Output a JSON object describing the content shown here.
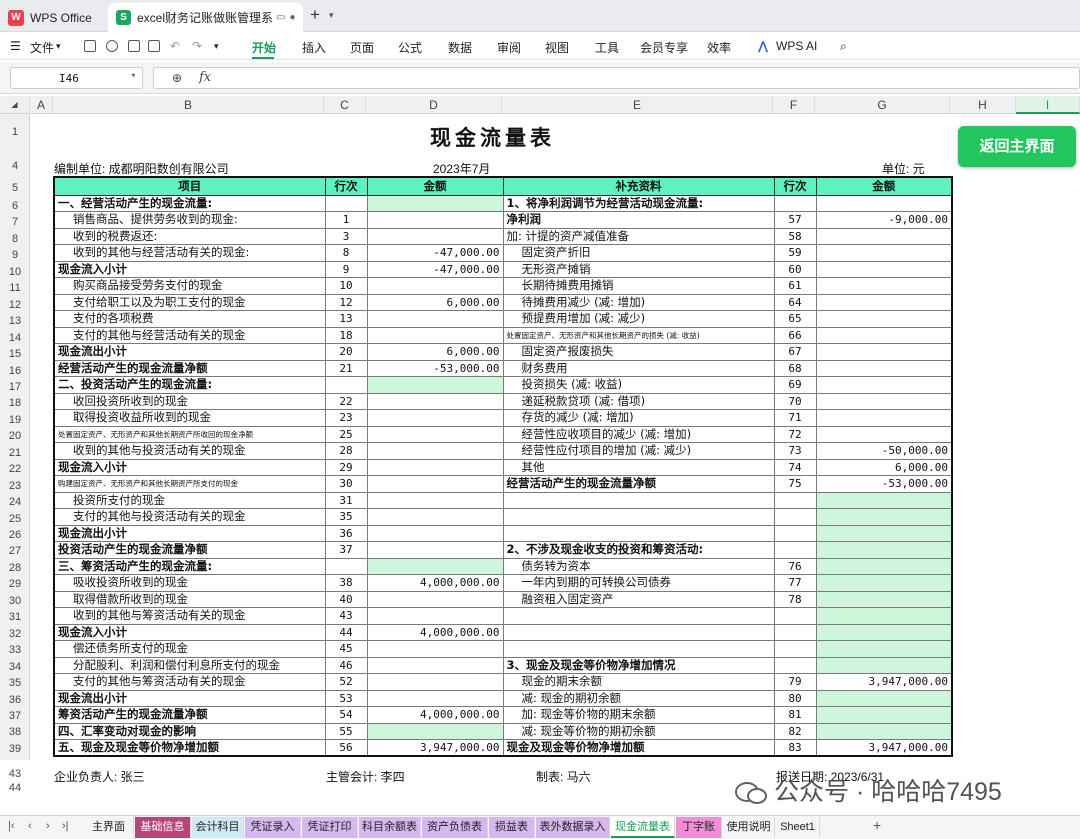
{
  "tabs": {
    "app": "WPS Office",
    "file": "excel财务记账做账管理系统"
  },
  "menu": {
    "file": "文件",
    "items": [
      "开始",
      "插入",
      "页面",
      "公式",
      "数据",
      "审阅",
      "视图",
      "工具",
      "会员专享",
      "效率"
    ],
    "ai": "WPS AI"
  },
  "formula": {
    "cell": "I46",
    "content": ""
  },
  "columns": [
    "A",
    "B",
    "C",
    "D",
    "E",
    "F",
    "G",
    "H",
    "I"
  ],
  "rows": [
    "1",
    "4",
    "5",
    "6",
    "7",
    "8",
    "9",
    "10",
    "11",
    "12",
    "13",
    "14",
    "15",
    "16",
    "17",
    "18",
    "19",
    "20",
    "21",
    "22",
    "23",
    "24",
    "25",
    "26",
    "27",
    "28",
    "29",
    "30",
    "31",
    "32",
    "33",
    "34",
    "35",
    "36",
    "37",
    "38",
    "39",
    "43",
    "44"
  ],
  "report": {
    "title": "现金流量表",
    "unit_label": "编制单位: 成都明阳数创有限公司",
    "period": "2023年7月",
    "currency": "单位: 元",
    "return_button": "返回主界面",
    "headers": [
      "项目",
      "行次",
      "金额",
      "补充资料",
      "行次",
      "金额"
    ],
    "left": [
      {
        "item": "一、经营活动产生的现金流量:",
        "ln": "",
        "amt": "",
        "style": "b",
        "green": true
      },
      {
        "item": "销售商品、提供劳务收到的现金:",
        "ln": "1",
        "amt": "",
        "style": "i1"
      },
      {
        "item": "收到的税费返还:",
        "ln": "3",
        "amt": "",
        "style": "i1"
      },
      {
        "item": "收到的其他与经营活动有关的现金:",
        "ln": "8",
        "amt": "-47,000.00",
        "style": "i1"
      },
      {
        "item": "现金流入小计",
        "ln": "9",
        "amt": "-47,000.00",
        "style": "b"
      },
      {
        "item": "购买商品接受劳务支付的现金",
        "ln": "10",
        "amt": "",
        "style": "i1"
      },
      {
        "item": "支付给职工以及为职工支付的现金",
        "ln": "12",
        "amt": "6,000.00",
        "style": "i1"
      },
      {
        "item": "支付的各项税费",
        "ln": "13",
        "amt": "",
        "style": "i1"
      },
      {
        "item": "支付的其他与经营活动有关的现金",
        "ln": "18",
        "amt": "",
        "style": "i1"
      },
      {
        "item": "现金流出小计",
        "ln": "20",
        "amt": "6,000.00",
        "style": "b"
      },
      {
        "item": "经营活动产生的现金流量净额",
        "ln": "21",
        "amt": "-53,000.00",
        "style": "b"
      },
      {
        "item": "二、投资活动产生的现金流量:",
        "ln": "",
        "amt": "",
        "style": "b",
        "green": true
      },
      {
        "item": "收回投资所收到的现金",
        "ln": "22",
        "amt": "",
        "style": "i1"
      },
      {
        "item": "取得投资收益所收到的现金",
        "ln": "23",
        "amt": "",
        "style": "i1"
      },
      {
        "item": "处置固定资产、无形资产和其他长期资产所收回的现金净额",
        "ln": "25",
        "amt": "",
        "style": "sm"
      },
      {
        "item": "收到的其他与投资活动有关的现金",
        "ln": "28",
        "amt": "",
        "style": "i1"
      },
      {
        "item": "现金流入小计",
        "ln": "29",
        "amt": "",
        "style": "b"
      },
      {
        "item": "购建固定资产、无形资产和其他长期资产所支付的现金",
        "ln": "30",
        "amt": "",
        "style": "sm"
      },
      {
        "item": "投资所支付的现金",
        "ln": "31",
        "amt": "",
        "style": "i1"
      },
      {
        "item": "支付的其他与投资活动有关的现金",
        "ln": "35",
        "amt": "",
        "style": "i1"
      },
      {
        "item": "现金流出小计",
        "ln": "36",
        "amt": "",
        "style": "b"
      },
      {
        "item": "投资活动产生的现金流量净额",
        "ln": "37",
        "amt": "",
        "style": "b"
      },
      {
        "item": "三、筹资活动产生的现金流量:",
        "ln": "",
        "amt": "",
        "style": "b",
        "green": true
      },
      {
        "item": "吸收投资所收到的现金",
        "ln": "38",
        "amt": "4,000,000.00",
        "style": "i1"
      },
      {
        "item": "取得借款所收到的现金",
        "ln": "40",
        "amt": "",
        "style": "i1"
      },
      {
        "item": "收到的其他与筹资活动有关的现金",
        "ln": "43",
        "amt": "",
        "style": "i1"
      },
      {
        "item": "现金流入小计",
        "ln": "44",
        "amt": "4,000,000.00",
        "style": "b"
      },
      {
        "item": "偿还债务所支付的现金",
        "ln": "45",
        "amt": "",
        "style": "i1"
      },
      {
        "item": "分配股利、利润和偿付利息所支付的现金",
        "ln": "46",
        "amt": "",
        "style": "i1"
      },
      {
        "item": "支付的其他与筹资活动有关的现金",
        "ln": "52",
        "amt": "",
        "style": "i1"
      },
      {
        "item": "现金流出小计",
        "ln": "53",
        "amt": "",
        "style": "b"
      },
      {
        "item": "筹资活动产生的现金流量净额",
        "ln": "54",
        "amt": "4,000,000.00",
        "style": "b"
      },
      {
        "item": "四、汇率变动对现金的影响",
        "ln": "55",
        "amt": "",
        "style": "b",
        "green": true
      },
      {
        "item": "五、现金及现金等价物净增加额",
        "ln": "56",
        "amt": "3,947,000.00",
        "style": "b"
      }
    ],
    "right": [
      {
        "item": "1、将净利润调节为经营活动现金流量:",
        "ln": "",
        "amt": "",
        "style": "b"
      },
      {
        "item": "净利润",
        "ln": "57",
        "amt": "-9,000.00",
        "style": "b"
      },
      {
        "item": "加: 计提的资产减值准备",
        "ln": "58",
        "amt": "",
        "style": ""
      },
      {
        "item": "固定资产折旧",
        "ln": "59",
        "amt": "",
        "style": "i1"
      },
      {
        "item": "无形资产摊销",
        "ln": "60",
        "amt": "",
        "style": "i1"
      },
      {
        "item": "长期待摊费用摊销",
        "ln": "61",
        "amt": "",
        "style": "i1"
      },
      {
        "item": "待摊费用减少 (减: 增加)",
        "ln": "64",
        "amt": "",
        "style": "i1"
      },
      {
        "item": "预提费用增加 (减: 减少)",
        "ln": "65",
        "amt": "",
        "style": "i1"
      },
      {
        "item": "处置固定资产、无形资产和其他长期资产的损失 (减: 收益)",
        "ln": "66",
        "amt": "",
        "style": "sm"
      },
      {
        "item": "固定资产报废损失",
        "ln": "67",
        "amt": "",
        "style": "i1"
      },
      {
        "item": "财务费用",
        "ln": "68",
        "amt": "",
        "style": "i1"
      },
      {
        "item": "投资损失 (减: 收益)",
        "ln": "69",
        "amt": "",
        "style": "i1"
      },
      {
        "item": "递延税款贷项 (减: 借项)",
        "ln": "70",
        "amt": "",
        "style": "i1"
      },
      {
        "item": "存货的减少 (减: 增加)",
        "ln": "71",
        "amt": "",
        "style": "i1"
      },
      {
        "item": "经营性应收项目的减少 (减: 增加)",
        "ln": "72",
        "amt": "",
        "style": "i1"
      },
      {
        "item": "经营性应付项目的增加 (减: 减少)",
        "ln": "73",
        "amt": "-50,000.00",
        "style": "i1"
      },
      {
        "item": "其他",
        "ln": "74",
        "amt": "6,000.00",
        "style": "i1"
      },
      {
        "item": "经营活动产生的现金流量净额",
        "ln": "75",
        "amt": "-53,000.00",
        "style": "b"
      },
      {
        "item": "",
        "ln": "",
        "amt": "",
        "style": "",
        "green": true
      },
      {
        "item": "",
        "ln": "",
        "amt": "",
        "style": "",
        "green": true
      },
      {
        "item": "",
        "ln": "",
        "amt": "",
        "style": "",
        "green": true
      },
      {
        "item": "2、不涉及现金收支的投资和筹资活动:",
        "ln": "",
        "amt": "",
        "style": "b",
        "green": true
      },
      {
        "item": "债务转为资本",
        "ln": "76",
        "amt": "",
        "style": "i1",
        "green": true
      },
      {
        "item": "一年内到期的可转换公司债券",
        "ln": "77",
        "amt": "",
        "style": "i1",
        "green": true
      },
      {
        "item": "融资租入固定资产",
        "ln": "78",
        "amt": "",
        "style": "i1",
        "green": true
      },
      {
        "item": "",
        "ln": "",
        "amt": "",
        "style": "",
        "green": true
      },
      {
        "item": "",
        "ln": "",
        "amt": "",
        "style": "",
        "green": true
      },
      {
        "item": "",
        "ln": "",
        "amt": "",
        "style": "",
        "green": true
      },
      {
        "item": "3、现金及现金等价物净增加情况",
        "ln": "",
        "amt": "",
        "style": "b",
        "green": true
      },
      {
        "item": "现金的期末余额",
        "ln": "79",
        "amt": "3,947,000.00",
        "style": "i1"
      },
      {
        "item": "减: 现金的期初余额",
        "ln": "80",
        "amt": "",
        "style": "i1",
        "green": true
      },
      {
        "item": "加: 现金等价物的期末余额",
        "ln": "81",
        "amt": "",
        "style": "i1",
        "green": true
      },
      {
        "item": "减: 现金等价物的期初余额",
        "ln": "82",
        "amt": "",
        "style": "i1",
        "green": true
      },
      {
        "item": "现金及现金等价物净增加额",
        "ln": "83",
        "amt": "3,947,000.00",
        "style": "b"
      }
    ],
    "footer": {
      "manager": "企业负责人: 张三",
      "accountant": "主管会计: 李四",
      "preparer": "制表: 马六",
      "date": "报送日期: 2023/6/31"
    }
  },
  "sheet_tabs": [
    {
      "label": "主界面",
      "color": "#f4f5f7"
    },
    {
      "label": "基础信息",
      "color": "#b7457a"
    },
    {
      "label": "会计科目",
      "color": "#cfe9f5"
    },
    {
      "label": "凭证录入",
      "color": "#d7b7f0"
    },
    {
      "label": "凭证打印",
      "color": "#d7b7f0"
    },
    {
      "label": "科目余额表",
      "color": "#d7b7f0"
    },
    {
      "label": "资产负债表",
      "color": "#d7b7f0"
    },
    {
      "label": "损益表",
      "color": "#d7b7f0"
    },
    {
      "label": "表外数据录入",
      "color": "#d7b7f0"
    },
    {
      "label": "现金流量表",
      "color": "#ffffff"
    },
    {
      "label": "丁字账",
      "color": "#f08fd8"
    },
    {
      "label": "使用说明",
      "color": "#f4f5f7"
    },
    {
      "label": "Sheet1",
      "color": "#f4f5f7"
    }
  ],
  "watermark": "公众号 · 哈哈哈7495"
}
